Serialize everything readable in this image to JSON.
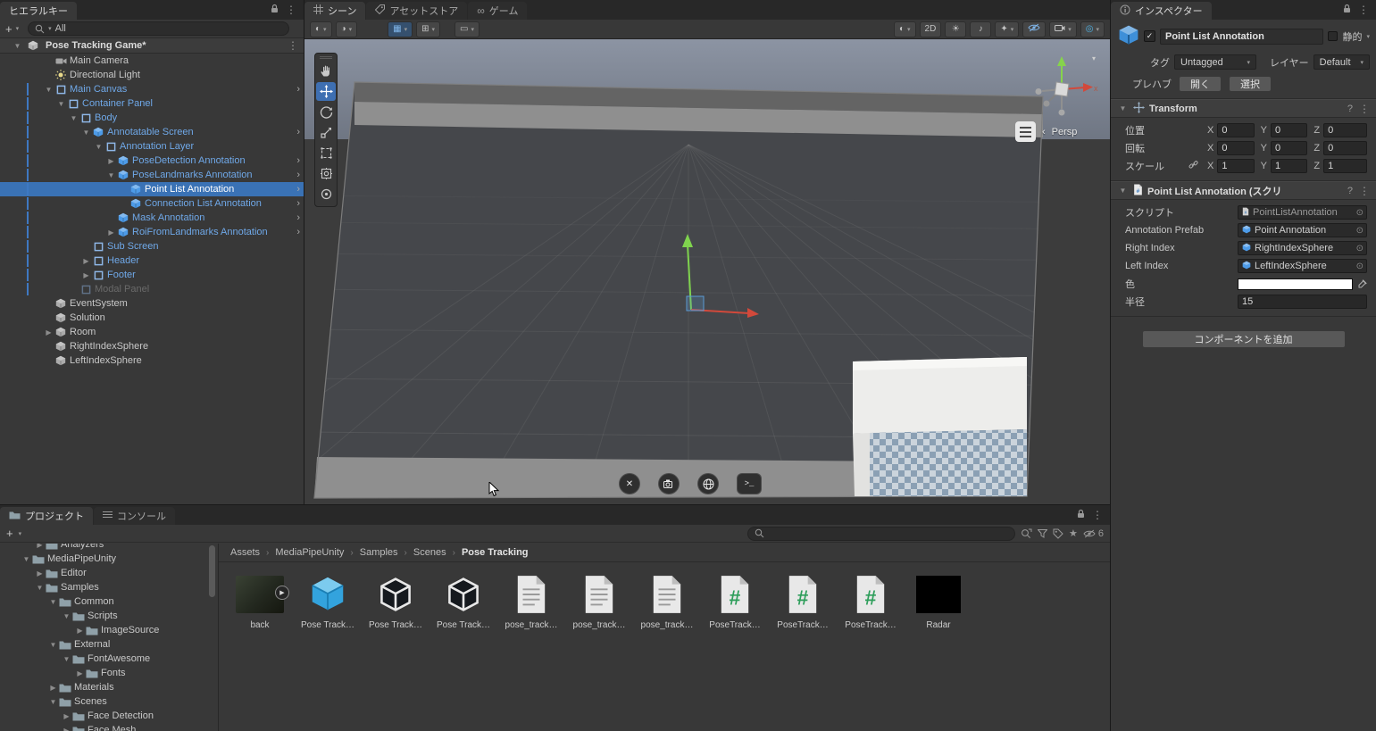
{
  "colors": {
    "panel_bg": "#383838",
    "selection_blue": "#3A72B5",
    "prefab_text_blue": "#6FA8E8",
    "prefab_icon_blue": "#4D9BE8",
    "color_field_value": "#FFFFFF"
  },
  "hierarchy": {
    "tab_label": "ヒエラルキー",
    "search_value": "All",
    "scene_name": "Pose Tracking Game*",
    "rows": [
      {
        "label": "Main Camera",
        "indent": 1,
        "icon": "camera",
        "style": "normal"
      },
      {
        "label": "Directional Light",
        "indent": 1,
        "icon": "light",
        "style": "normal"
      },
      {
        "label": "Main Canvas",
        "indent": 1,
        "icon": "canvas",
        "style": "prefab",
        "expand": "open",
        "chevron": true,
        "bar": true
      },
      {
        "label": "Container Panel",
        "indent": 2,
        "icon": "rect",
        "style": "prefab",
        "expand": "open",
        "bar": true
      },
      {
        "label": "Body",
        "indent": 3,
        "icon": "rect",
        "style": "prefab",
        "expand": "open",
        "bar": true
      },
      {
        "label": "Annotatable Screen",
        "indent": 4,
        "icon": "prefab",
        "style": "prefab",
        "expand": "open",
        "chevron": true,
        "bar": true
      },
      {
        "label": "Annotation Layer",
        "indent": 5,
        "icon": "rect",
        "style": "prefab",
        "expand": "open",
        "bar": true
      },
      {
        "label": "PoseDetection Annotation",
        "indent": 6,
        "icon": "prefab",
        "style": "prefab",
        "expand": "closed",
        "chevron": true,
        "bar": true
      },
      {
        "label": "PoseLandmarks Annotation",
        "indent": 6,
        "icon": "prefab",
        "style": "prefab",
        "expand": "open",
        "chevron": true,
        "bar": true
      },
      {
        "label": "Point List Annotation",
        "indent": 7,
        "icon": "prefab",
        "style": "selected",
        "chevron": true,
        "bar": true
      },
      {
        "label": "Connection List Annotation",
        "indent": 7,
        "icon": "prefab",
        "style": "prefab",
        "chevron": true,
        "bar": true
      },
      {
        "label": "Mask Annotation",
        "indent": 6,
        "icon": "prefab",
        "style": "prefab",
        "chevron": true,
        "bar": true
      },
      {
        "label": "RoiFromLandmarks Annotation",
        "indent": 6,
        "icon": "prefab",
        "style": "prefab",
        "expand": "closed",
        "chevron": true,
        "bar": true
      },
      {
        "label": "Sub Screen",
        "indent": 4,
        "icon": "rect",
        "style": "prefab",
        "bar": true
      },
      {
        "label": "Header",
        "indent": 4,
        "icon": "rect",
        "style": "prefab",
        "expand": "closed",
        "bar": true
      },
      {
        "label": "Footer",
        "indent": 4,
        "icon": "rect",
        "style": "prefab",
        "expand": "closed",
        "bar": true
      },
      {
        "label": "Modal Panel",
        "indent": 3,
        "icon": "rect",
        "style": "disabled",
        "bar": true
      },
      {
        "label": "EventSystem",
        "indent": 1,
        "icon": "object",
        "style": "normal"
      },
      {
        "label": "Solution",
        "indent": 1,
        "icon": "object",
        "style": "normal"
      },
      {
        "label": "Room",
        "indent": 1,
        "icon": "object",
        "style": "normal",
        "expand": "closed"
      },
      {
        "label": "RightIndexSphere",
        "indent": 1,
        "icon": "object",
        "style": "normal"
      },
      {
        "label": "LeftIndexSphere",
        "indent": 1,
        "icon": "object",
        "style": "normal"
      }
    ]
  },
  "scene": {
    "tabs": [
      {
        "label": "シーン"
      },
      {
        "label": "アセットストア"
      },
      {
        "label": "ゲーム"
      }
    ],
    "toolbar_2d": "2D",
    "persp_label": "Persp",
    "terminal_label": ">_"
  },
  "inspector": {
    "tab_label": "インスペクター",
    "object_name": "Point List Annotation",
    "static_label": "静的",
    "tag_label": "タグ",
    "tag_value": "Untagged",
    "layer_label": "レイヤー",
    "layer_value": "Default",
    "prefab_label": "プレハブ",
    "open_button": "開く",
    "select_button": "選択",
    "transform": {
      "title": "Transform",
      "position_label": "位置",
      "rotation_label": "回転",
      "scale_label": "スケール",
      "x_label": "X",
      "y_label": "Y",
      "z_label": "Z",
      "position": {
        "x": "0",
        "y": "0",
        "z": "0"
      },
      "rotation": {
        "x": "0",
        "y": "0",
        "z": "0"
      },
      "scale": {
        "x": "1",
        "y": "1",
        "z": "1"
      }
    },
    "script_component": {
      "title": "Point List Annotation (スクリ",
      "rows": [
        {
          "label": "スクリプト",
          "value": "PointListAnnotation"
        },
        {
          "label": "Annotation Prefab",
          "value": "Point Annotation"
        },
        {
          "label": "Right Index",
          "value": "RightIndexSphere"
        },
        {
          "label": "Left Index",
          "value": "LeftIndexSphere"
        }
      ],
      "color_label": "色",
      "color_value": "#FFFFFF",
      "radius_label": "半径",
      "radius_value": "15"
    },
    "add_component_label": "コンポーネントを追加"
  },
  "project": {
    "tab_label": "プロジェクト",
    "console_tab_label": "コンソール",
    "breadcrumb": [
      "Assets",
      "MediaPipeUnity",
      "Samples",
      "Scenes",
      "Pose Tracking"
    ],
    "hidden_count": "6",
    "tree": [
      {
        "label": "Analyzers",
        "indent": 2,
        "expand": "closed"
      },
      {
        "label": "MediaPipeUnity",
        "indent": 1,
        "expand": "open"
      },
      {
        "label": "Editor",
        "indent": 2,
        "expand": "closed"
      },
      {
        "label": "Samples",
        "indent": 2,
        "expand": "open"
      },
      {
        "label": "Common",
        "indent": 3,
        "expand": "open"
      },
      {
        "label": "Scripts",
        "indent": 4,
        "expand": "open"
      },
      {
        "label": "ImageSource",
        "indent": 5,
        "expand": "closed"
      },
      {
        "label": "External",
        "indent": 3,
        "expand": "open"
      },
      {
        "label": "FontAwesome",
        "indent": 4,
        "expand": "open"
      },
      {
        "label": "Fonts",
        "indent": 5,
        "expand": "closed"
      },
      {
        "label": "Materials",
        "indent": 3,
        "expand": "closed"
      },
      {
        "label": "Scenes",
        "indent": 3,
        "expand": "open"
      },
      {
        "label": "Face Detection",
        "indent": 4,
        "expand": "closed"
      },
      {
        "label": "Face Mesh",
        "indent": 4,
        "expand": "closed"
      }
    ],
    "files": [
      {
        "label": "back",
        "type": "image"
      },
      {
        "label": "Pose Track…",
        "type": "prefab"
      },
      {
        "label": "Pose Track…",
        "type": "model"
      },
      {
        "label": "Pose Track…",
        "type": "model"
      },
      {
        "label": "pose_track…",
        "type": "text"
      },
      {
        "label": "pose_track…",
        "type": "text"
      },
      {
        "label": "pose_track…",
        "type": "text"
      },
      {
        "label": "PoseTrack…",
        "type": "script"
      },
      {
        "label": "PoseTrack…",
        "type": "script"
      },
      {
        "label": "PoseTrack…",
        "type": "script"
      },
      {
        "label": "Radar",
        "type": "texture"
      }
    ]
  }
}
